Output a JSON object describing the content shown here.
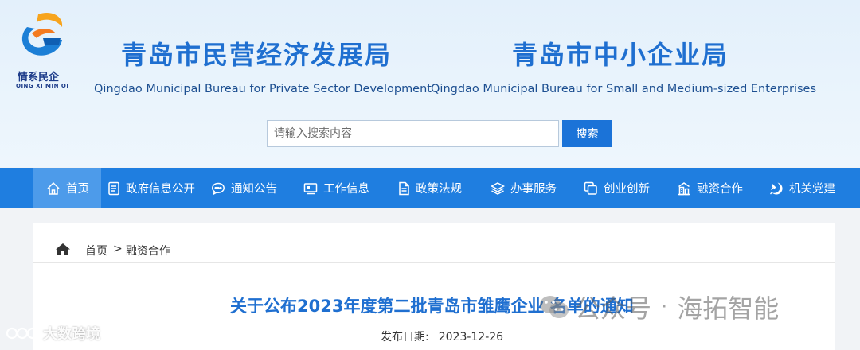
{
  "logo": {
    "cn": "情系民企",
    "en": "QING XI MIN QI"
  },
  "bureaus": [
    {
      "cn": "青岛市民营经济发展局",
      "en": "Qingdao Municipal Bureau for Private Sector Development"
    },
    {
      "cn": "青岛市中小企业局",
      "en": "Qingdao Municipal Bureau for Small and Medium-sized Enterprises"
    }
  ],
  "search": {
    "placeholder": "请输入搜索内容",
    "button": "搜索"
  },
  "nav": [
    {
      "label": "首页",
      "icon": "home-icon",
      "active": true
    },
    {
      "label": "政府信息公开",
      "icon": "document-icon"
    },
    {
      "label": "通知公告",
      "icon": "chat-icon"
    },
    {
      "label": "工作信息",
      "icon": "monitor-icon"
    },
    {
      "label": "政策法规",
      "icon": "file-icon"
    },
    {
      "label": "办事服务",
      "icon": "layers-icon"
    },
    {
      "label": "创业创新",
      "icon": "copy-icon"
    },
    {
      "label": "融资合作",
      "icon": "building-icon"
    },
    {
      "label": "机关党建",
      "icon": "party-emblem-icon"
    }
  ],
  "breadcrumb": {
    "home": "首页",
    "separator": ">",
    "current": "融资合作"
  },
  "article": {
    "title": "关于公布2023年度第二批青岛市雏鹰企业 名单的通知",
    "date_label": "发布日期:",
    "date": "2023-12-26"
  },
  "watermarks": {
    "wechat": "公众号",
    "dot": "·",
    "account": "海拓智能",
    "brand": "大数跨境"
  },
  "colors": {
    "nav_bg": "#1f7ee0",
    "nav_active": "#4d9bea",
    "title_blue": "#1f6fd0",
    "button_blue": "#1b73d8"
  }
}
